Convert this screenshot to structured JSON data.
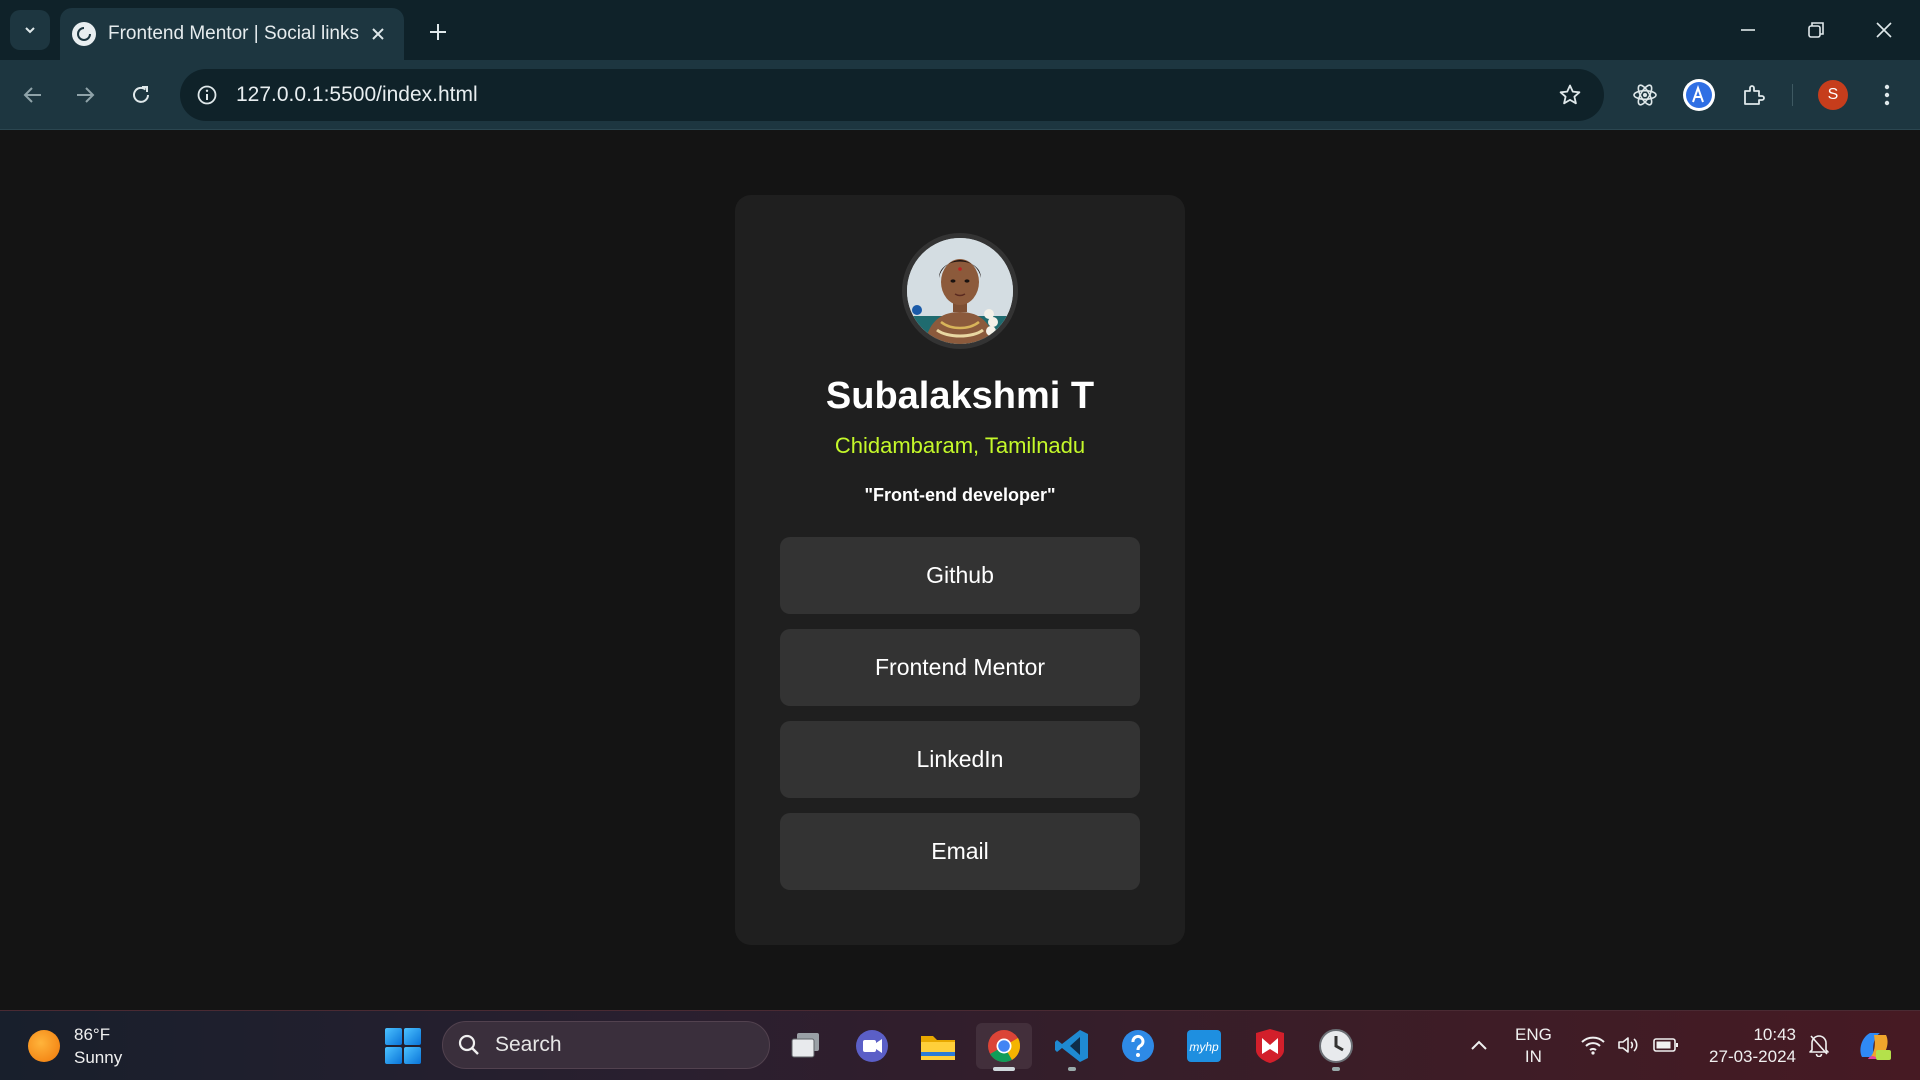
{
  "browser": {
    "tab_title": "Frontend Mentor | Social links p",
    "url": "127.0.0.1:5500/index.html",
    "profile_initial": "S"
  },
  "profile": {
    "name": "Subalakshmi T",
    "location": "Chidambaram, Tamilnadu",
    "bio": "\"Front-end developer\"",
    "links": [
      "Github",
      "Frontend Mentor",
      "LinkedIn",
      "Email"
    ]
  },
  "taskbar": {
    "temperature": "86°F",
    "condition": "Sunny",
    "search_label": "Search",
    "lang_primary": "ENG",
    "lang_region": "IN",
    "time": "10:43",
    "date": "27-03-2024"
  },
  "colors": {
    "accent": "#c4f82a",
    "card": "#1f1f1f",
    "button": "#333333",
    "page_bg": "#141414",
    "chrome": "#1d3640"
  }
}
